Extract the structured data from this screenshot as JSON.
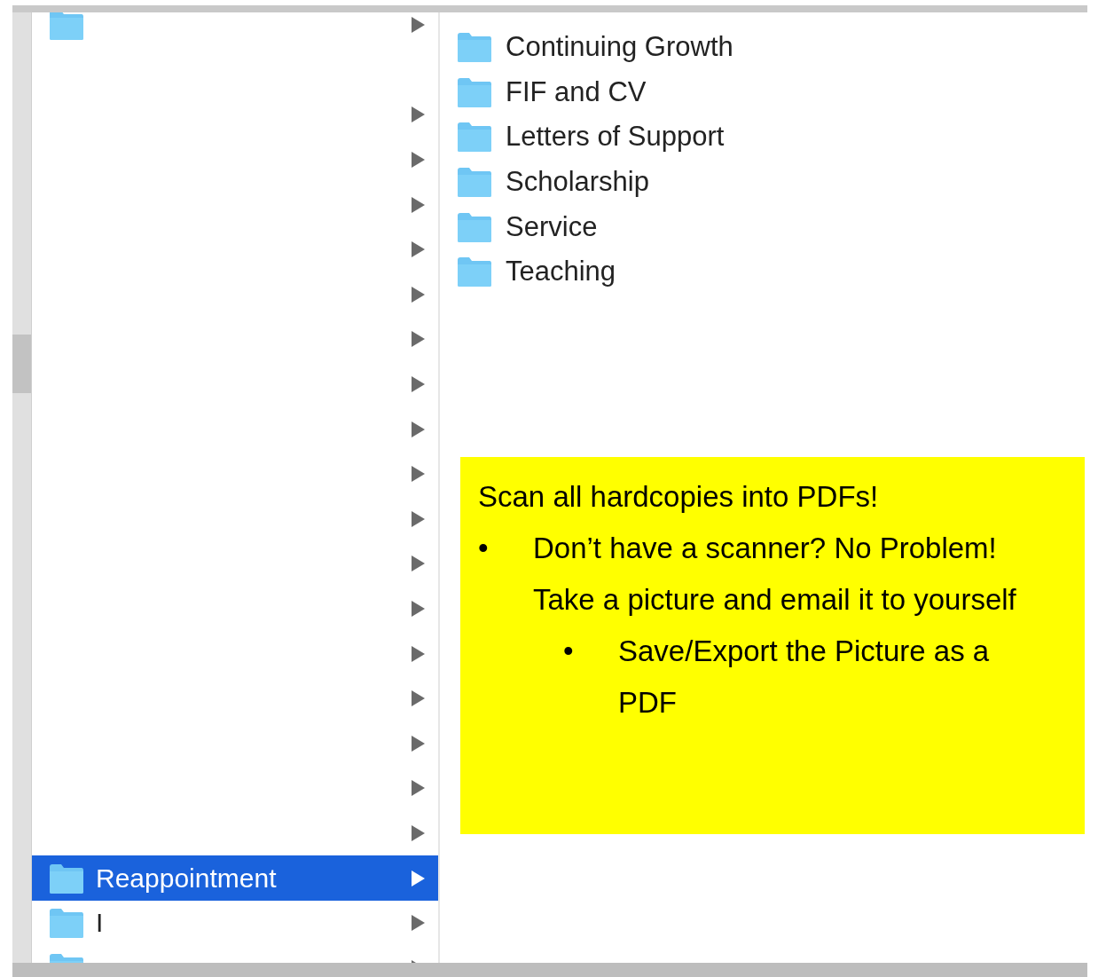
{
  "left_column": {
    "items": [
      {
        "has_children": true,
        "icon": true,
        "selected": false
      },
      {
        "has_children": false,
        "icon": false,
        "selected": false
      },
      {
        "has_children": true,
        "icon": false,
        "selected": false
      },
      {
        "has_children": true,
        "icon": false,
        "selected": false
      },
      {
        "has_children": true,
        "icon": false,
        "selected": false
      },
      {
        "has_children": true,
        "icon": false,
        "selected": false
      },
      {
        "has_children": true,
        "icon": false,
        "selected": false
      },
      {
        "has_children": true,
        "icon": false,
        "selected": false
      },
      {
        "has_children": true,
        "icon": false,
        "selected": false
      },
      {
        "has_children": true,
        "icon": false,
        "selected": false
      },
      {
        "has_children": true,
        "icon": false,
        "selected": false
      },
      {
        "has_children": true,
        "icon": false,
        "selected": false
      },
      {
        "has_children": true,
        "icon": false,
        "selected": false
      },
      {
        "has_children": true,
        "icon": false,
        "selected": false
      },
      {
        "has_children": true,
        "icon": false,
        "selected": false
      },
      {
        "has_children": true,
        "icon": false,
        "selected": false
      },
      {
        "has_children": true,
        "icon": false,
        "selected": false
      },
      {
        "has_children": true,
        "icon": false,
        "selected": false
      },
      {
        "has_children": true,
        "icon": false,
        "selected": false
      },
      {
        "label": "Reappointment",
        "has_children": true,
        "icon": true,
        "selected": true
      },
      {
        "label": "I",
        "has_children": true,
        "icon": true,
        "selected": false
      },
      {
        "has_children": true,
        "icon": true,
        "selected": false
      }
    ]
  },
  "right_column": {
    "items": [
      {
        "label": "Continuing Growth"
      },
      {
        "label": "FIF and CV"
      },
      {
        "label": "Letters of Support"
      },
      {
        "label": "Scholarship"
      },
      {
        "label": "Service"
      },
      {
        "label": "Teaching"
      }
    ]
  },
  "callout": {
    "heading": "Scan all hardcopies into PDFs!",
    "bullets": [
      {
        "marker": "•",
        "text": "Don’t have a scanner? No Problem!  Take a picture and email it to yourself",
        "children": [
          {
            "marker": "•",
            "text": "Save/Export the Picture as a PDF"
          }
        ]
      }
    ]
  }
}
